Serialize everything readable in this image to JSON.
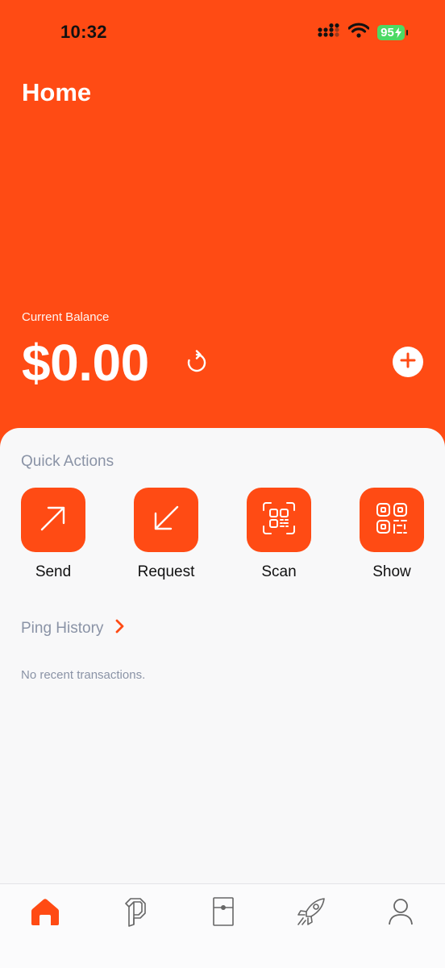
{
  "status_bar": {
    "time": "10:32",
    "battery": "95",
    "icons": [
      "cellular-signal-icon",
      "wifi-icon",
      "battery-charging-icon"
    ]
  },
  "header": {
    "title": "Home"
  },
  "balance": {
    "label": "Current Balance",
    "amount": "$0.00",
    "refresh_icon": "refresh-icon",
    "add_icon": "plus-icon"
  },
  "quick_actions": {
    "title": "Quick Actions",
    "items": [
      {
        "label": "Send",
        "icon": "arrow-up-right-icon"
      },
      {
        "label": "Request",
        "icon": "arrow-down-left-icon"
      },
      {
        "label": "Scan",
        "icon": "qr-scan-icon"
      },
      {
        "label": "Show",
        "icon": "qr-code-icon"
      }
    ]
  },
  "history": {
    "title": "Ping History",
    "empty_text": "No recent transactions."
  },
  "tab_bar": {
    "items": [
      {
        "icon": "home-icon",
        "active": true
      },
      {
        "icon": "ping-logo-icon",
        "active": false
      },
      {
        "icon": "card-icon",
        "active": false
      },
      {
        "icon": "rocket-icon",
        "active": false
      },
      {
        "icon": "profile-icon",
        "active": false
      }
    ]
  },
  "colors": {
    "accent": "#ff4b14",
    "background": "#f8f8f9",
    "muted_text": "#8a93a6",
    "battery": "#4cd964"
  }
}
